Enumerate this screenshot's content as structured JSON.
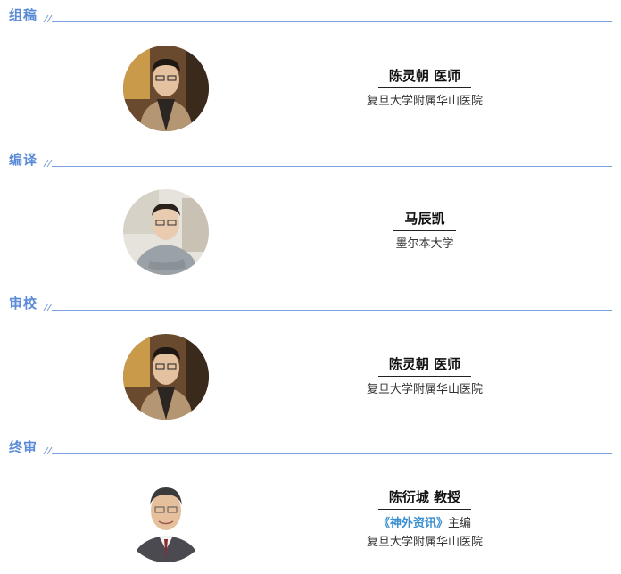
{
  "sections": [
    {
      "title": "组稿",
      "person": {
        "name": "陈灵朝 医师",
        "affiliation": "复旦大学附属华山医院"
      }
    },
    {
      "title": "编译",
      "person": {
        "name": "马辰凯",
        "affiliation": "墨尔本大学"
      }
    },
    {
      "title": "审校",
      "person": {
        "name": "陈灵朝 医师",
        "affiliation": "复旦大学附属华山医院"
      }
    },
    {
      "title": "终审",
      "person": {
        "name": "陈衍城 教授",
        "journal": "《神外资讯》",
        "journal_role": "主编",
        "affiliation": "复旦大学附属华山医院"
      }
    }
  ],
  "colors": {
    "section_title": "#5b8bd6",
    "rule": "#7aa0dd",
    "journal": "#3a8fd0"
  }
}
